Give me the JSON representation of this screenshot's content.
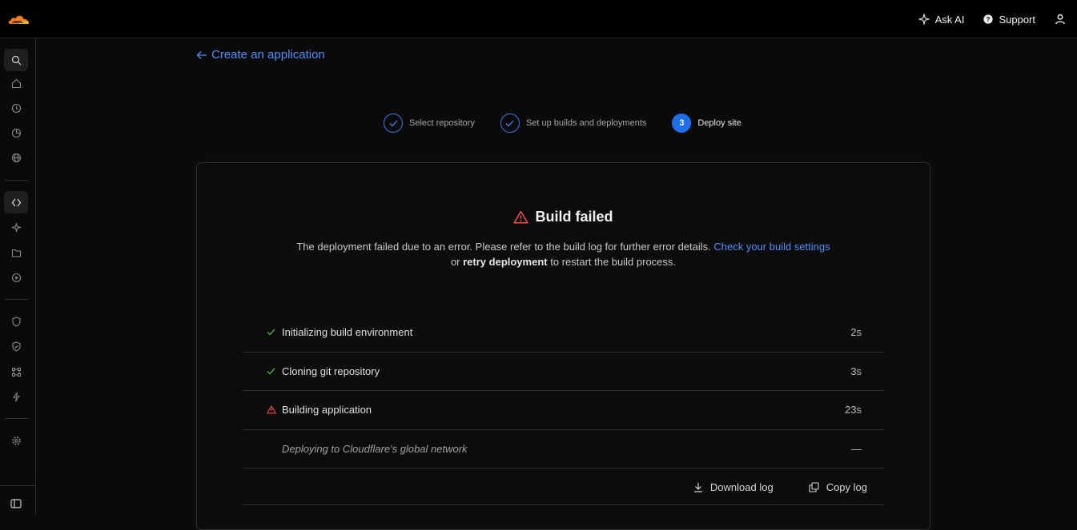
{
  "topbar": {
    "ask_ai_label": "Ask AI",
    "support_label": "Support"
  },
  "colors": {
    "accent": "#4f8ff7",
    "step_active": "#1f6feb",
    "success": "#3fb950",
    "error": "#f85149",
    "brand": "#f38020"
  },
  "sidebar": {
    "icons": [
      "search-icon",
      "home-icon",
      "history-icon",
      "clock-icon",
      "globe-icon",
      "code-icon",
      "sparkle-icon",
      "storage-icon",
      "play-icon",
      "shield-icon",
      "shield-check-icon",
      "network-icon",
      "lightning-icon",
      "settings-icon",
      "panel-toggle-icon"
    ]
  },
  "back_link": {
    "label": "Create an application"
  },
  "stepper": {
    "steps": [
      {
        "label": "Select repository",
        "state": "done"
      },
      {
        "label": "Set up builds and deployments",
        "state": "done"
      },
      {
        "label": "Deploy site",
        "state": "current",
        "number": "3"
      }
    ]
  },
  "build": {
    "title": "Build failed",
    "desc_part1": "The deployment failed due to an error. Please refer to the build log for further error details. ",
    "desc_link": "Check your build settings",
    "desc_or": "or ",
    "desc_bold": "retry deployment",
    "desc_part2": " to restart the build process."
  },
  "steps_list": [
    {
      "label": "Initializing build environment",
      "duration": "2s",
      "status": "success"
    },
    {
      "label": "Cloning git repository",
      "duration": "3s",
      "status": "success"
    },
    {
      "label": "Building application",
      "duration": "23s",
      "status": "error"
    },
    {
      "label": "Deploying to Cloudflare's global network",
      "duration": "—",
      "status": "pending"
    }
  ],
  "actions": {
    "download_label": "Download log",
    "copy_label": "Copy log"
  }
}
